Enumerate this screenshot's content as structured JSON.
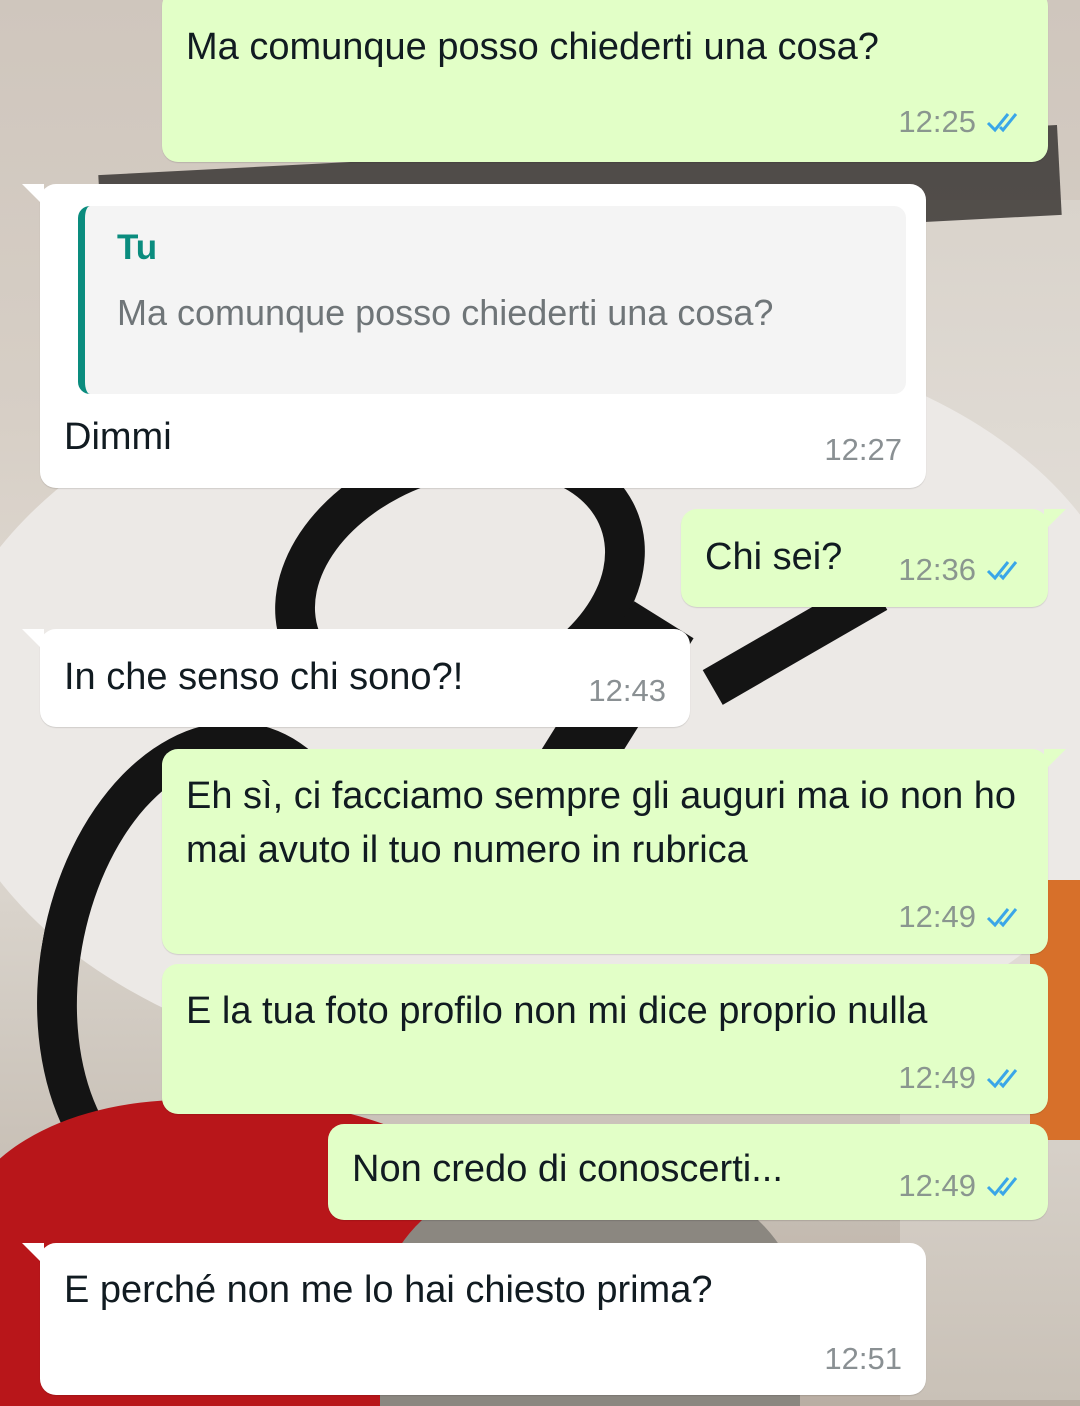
{
  "colors": {
    "outgoing_bubble": "#e2ffc7",
    "incoming_bubble": "#ffffff",
    "read_ticks": "#3aa6e8",
    "quote_accent": "#0a8c7e"
  },
  "messages": [
    {
      "direction": "out",
      "text": "Ma comunque posso chiederti una cosa?",
      "time": "12:25",
      "status_icon": "double-check-read-icon"
    },
    {
      "direction": "in",
      "quote": {
        "author": "Tu",
        "text": "Ma comunque posso chiederti una cosa?"
      },
      "text": "Dimmi",
      "time": "12:27"
    },
    {
      "direction": "out",
      "text": "Chi sei?",
      "time": "12:36",
      "status_icon": "double-check-read-icon"
    },
    {
      "direction": "in",
      "text": "In che senso chi sono?!",
      "time": "12:43"
    },
    {
      "direction": "out",
      "text": "Eh sì, ci facciamo sempre gli auguri ma io non ho mai avuto il tuo numero in rubrica",
      "time": "12:49",
      "status_icon": "double-check-read-icon"
    },
    {
      "direction": "out",
      "text": "E la tua foto profilo non mi dice proprio nulla",
      "time": "12:49",
      "status_icon": "double-check-read-icon"
    },
    {
      "direction": "out",
      "text": "Non credo di conoscerti...",
      "time": "12:49",
      "status_icon": "double-check-read-icon"
    },
    {
      "direction": "in",
      "text": "E perché non me lo hai chiesto prima?",
      "time": "12:51"
    }
  ]
}
